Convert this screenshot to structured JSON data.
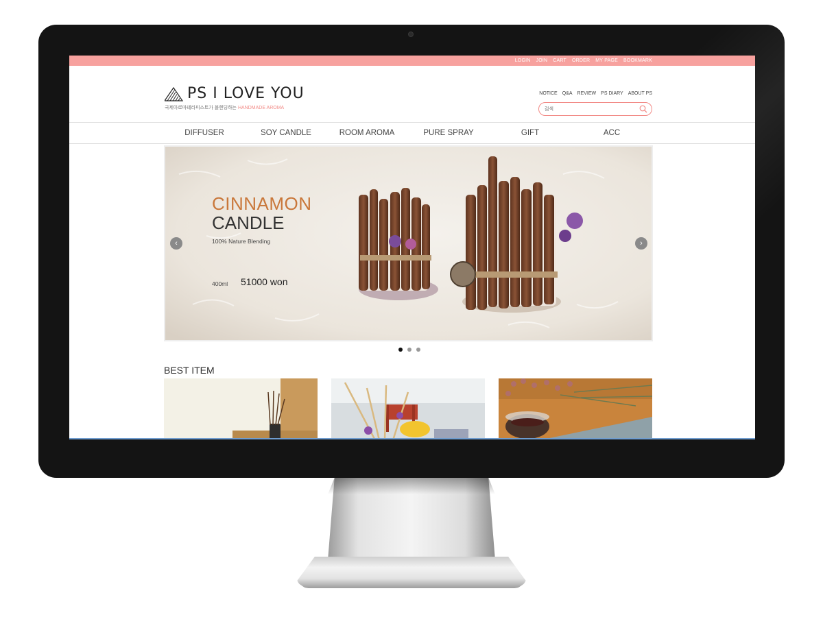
{
  "topbar": {
    "links": [
      "LOGIN",
      "JOIN",
      "CART",
      "ORDER",
      "MY PAGE",
      "BOOKMARK"
    ]
  },
  "logo": {
    "name": "PS I LOVE YOU",
    "tagline_ko": "국제아로마테라피스트가 블렌딩하는 ",
    "tagline_accent": "HANDMADE AROMA"
  },
  "util_links": [
    "NOTICE",
    "Q&A",
    "REVIEW",
    "PS DIARY",
    "ABOUT PS"
  ],
  "search": {
    "placeholder": "검색",
    "icon": "search-icon"
  },
  "nav": {
    "items": [
      "DIFFUSER",
      "SOY CANDLE",
      "ROOM AROMA",
      "PURE SPRAY",
      "GIFT",
      "ACC"
    ]
  },
  "slide": {
    "title_line1": "CINNAMON",
    "title_line2": "CANDLE",
    "subtitle": "100% Nature Blending",
    "size": "400ml",
    "price": "51000 won",
    "prev_icon": "chevron-left-icon",
    "next_icon": "chevron-right-icon",
    "dots": 3,
    "active_dot": 1
  },
  "best": {
    "title": "BEST ITEM"
  },
  "colors": {
    "accent_pink": "#f7a19e",
    "search_border": "#f28a86",
    "title_orange": "#c9773a"
  }
}
